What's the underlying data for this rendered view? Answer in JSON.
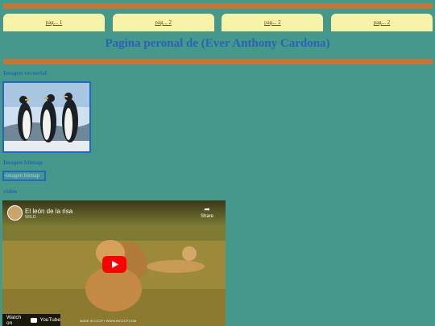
{
  "nav": {
    "tabs": [
      {
        "label": "pag... 1"
      },
      {
        "label": "pag... 2"
      },
      {
        "label": "pag... 2"
      },
      {
        "label": "pag... 2"
      }
    ]
  },
  "header": {
    "title": "Pagina peronal de (Ever Anthony Cardona)"
  },
  "sections": {
    "vector_label": "Imagen vectorial",
    "bitmap_label": "Imagen bitmap",
    "bitmap_alt": "imagen bitmap",
    "video_label": "video"
  },
  "video": {
    "title": "El león de la risa",
    "channel": "WILD",
    "share_label": "Share",
    "watch_on": "Watch on",
    "youtube": "YouTube",
    "watermark": "MADE IN CCCP ▪ WWW.INCCCP.COM"
  },
  "colors": {
    "background": "#46998a",
    "accent_bar": "#c0783a",
    "tab": "#f6f2a8",
    "heading": "#2a62b8"
  }
}
